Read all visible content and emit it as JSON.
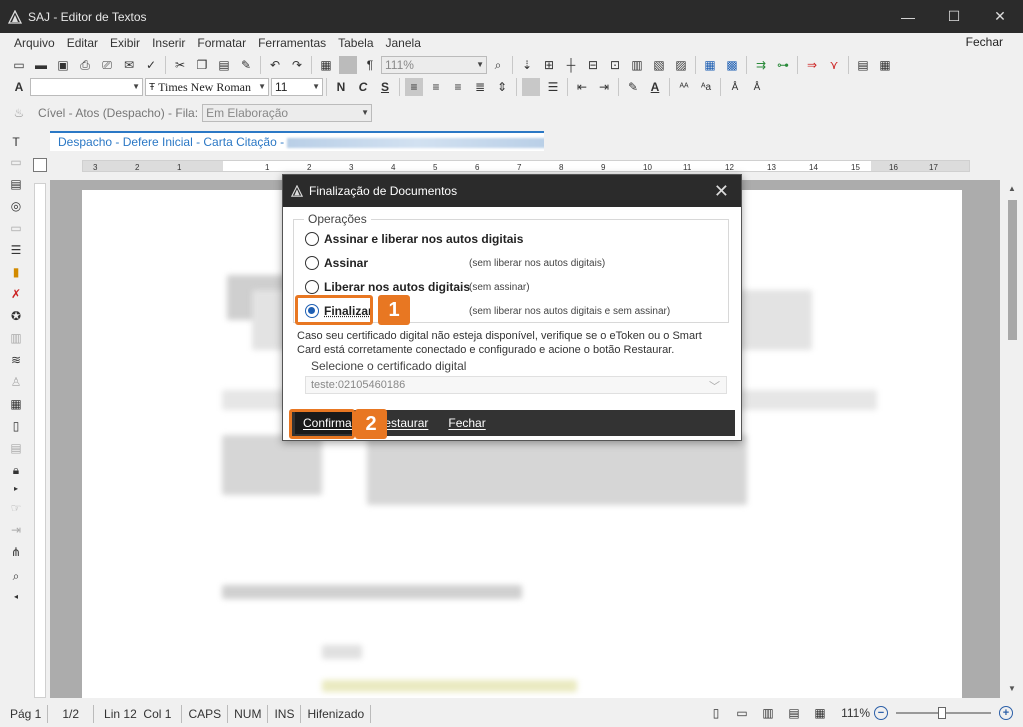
{
  "window": {
    "title": "SAJ - Editor de Textos",
    "minimize_glyph": "—",
    "maximize_glyph": "☐",
    "close_glyph": "✕"
  },
  "menu": {
    "items": [
      "Arquivo",
      "Editar",
      "Exibir",
      "Inserir",
      "Formatar",
      "Ferramentas",
      "Tabela",
      "Janela"
    ],
    "right": "Fechar"
  },
  "toolbar": {
    "zoom_value": "111%",
    "font_name": "Times New Roman",
    "font_size": "11",
    "pilcrow": "¶"
  },
  "context_bar": {
    "label_text": "Cível - Atos (Despacho) - Fila:",
    "fila_value": "Em Elaboração"
  },
  "doc_tab": {
    "label": "Despacho - Defere Inicial - Carta Citação - "
  },
  "ruler": {
    "ticks": [
      "3",
      "2",
      "1",
      "1",
      "2",
      "3",
      "4",
      "5",
      "6",
      "7",
      "8",
      "9",
      "10",
      "11",
      "12",
      "13",
      "14",
      "15",
      "16",
      "17"
    ]
  },
  "statusbar": {
    "page": "Pág 1",
    "pages": "1/2",
    "position": "Lin 12  Col 1",
    "caps": "CAPS",
    "num": "NUM",
    "ins": "INS",
    "hyphen": "Hifenizado",
    "zoom": "111%"
  },
  "dialog": {
    "title": "Finalização de Documentos",
    "group_label": "Operações",
    "options": [
      {
        "label": "Assinar e liberar nos autos digitais",
        "hint": "",
        "checked": false
      },
      {
        "label": "Assinar",
        "hint": "(sem liberar nos autos digitais)",
        "checked": false
      },
      {
        "label": "Liberar nos autos digitais",
        "hint": "(sem assinar)",
        "checked": false
      },
      {
        "label": "Finalizar",
        "hint": "(sem liberar nos autos digitais e sem assinar)",
        "checked": true
      }
    ],
    "info_text": "Caso seu certificado digital não esteja disponível, verifique se o eToken ou o Smart Card está corretamente conectado e configurado e acione o botão Restaurar.",
    "cert_group_label": "Selecione o certificado digital",
    "cert_value": "teste:02105460186",
    "buttons": {
      "confirm": "Confirmar",
      "restore": "Restaurar",
      "close": "Fechar"
    }
  },
  "annotations": {
    "step1": "1",
    "step2": "2",
    "accent_color": "#e87722"
  }
}
